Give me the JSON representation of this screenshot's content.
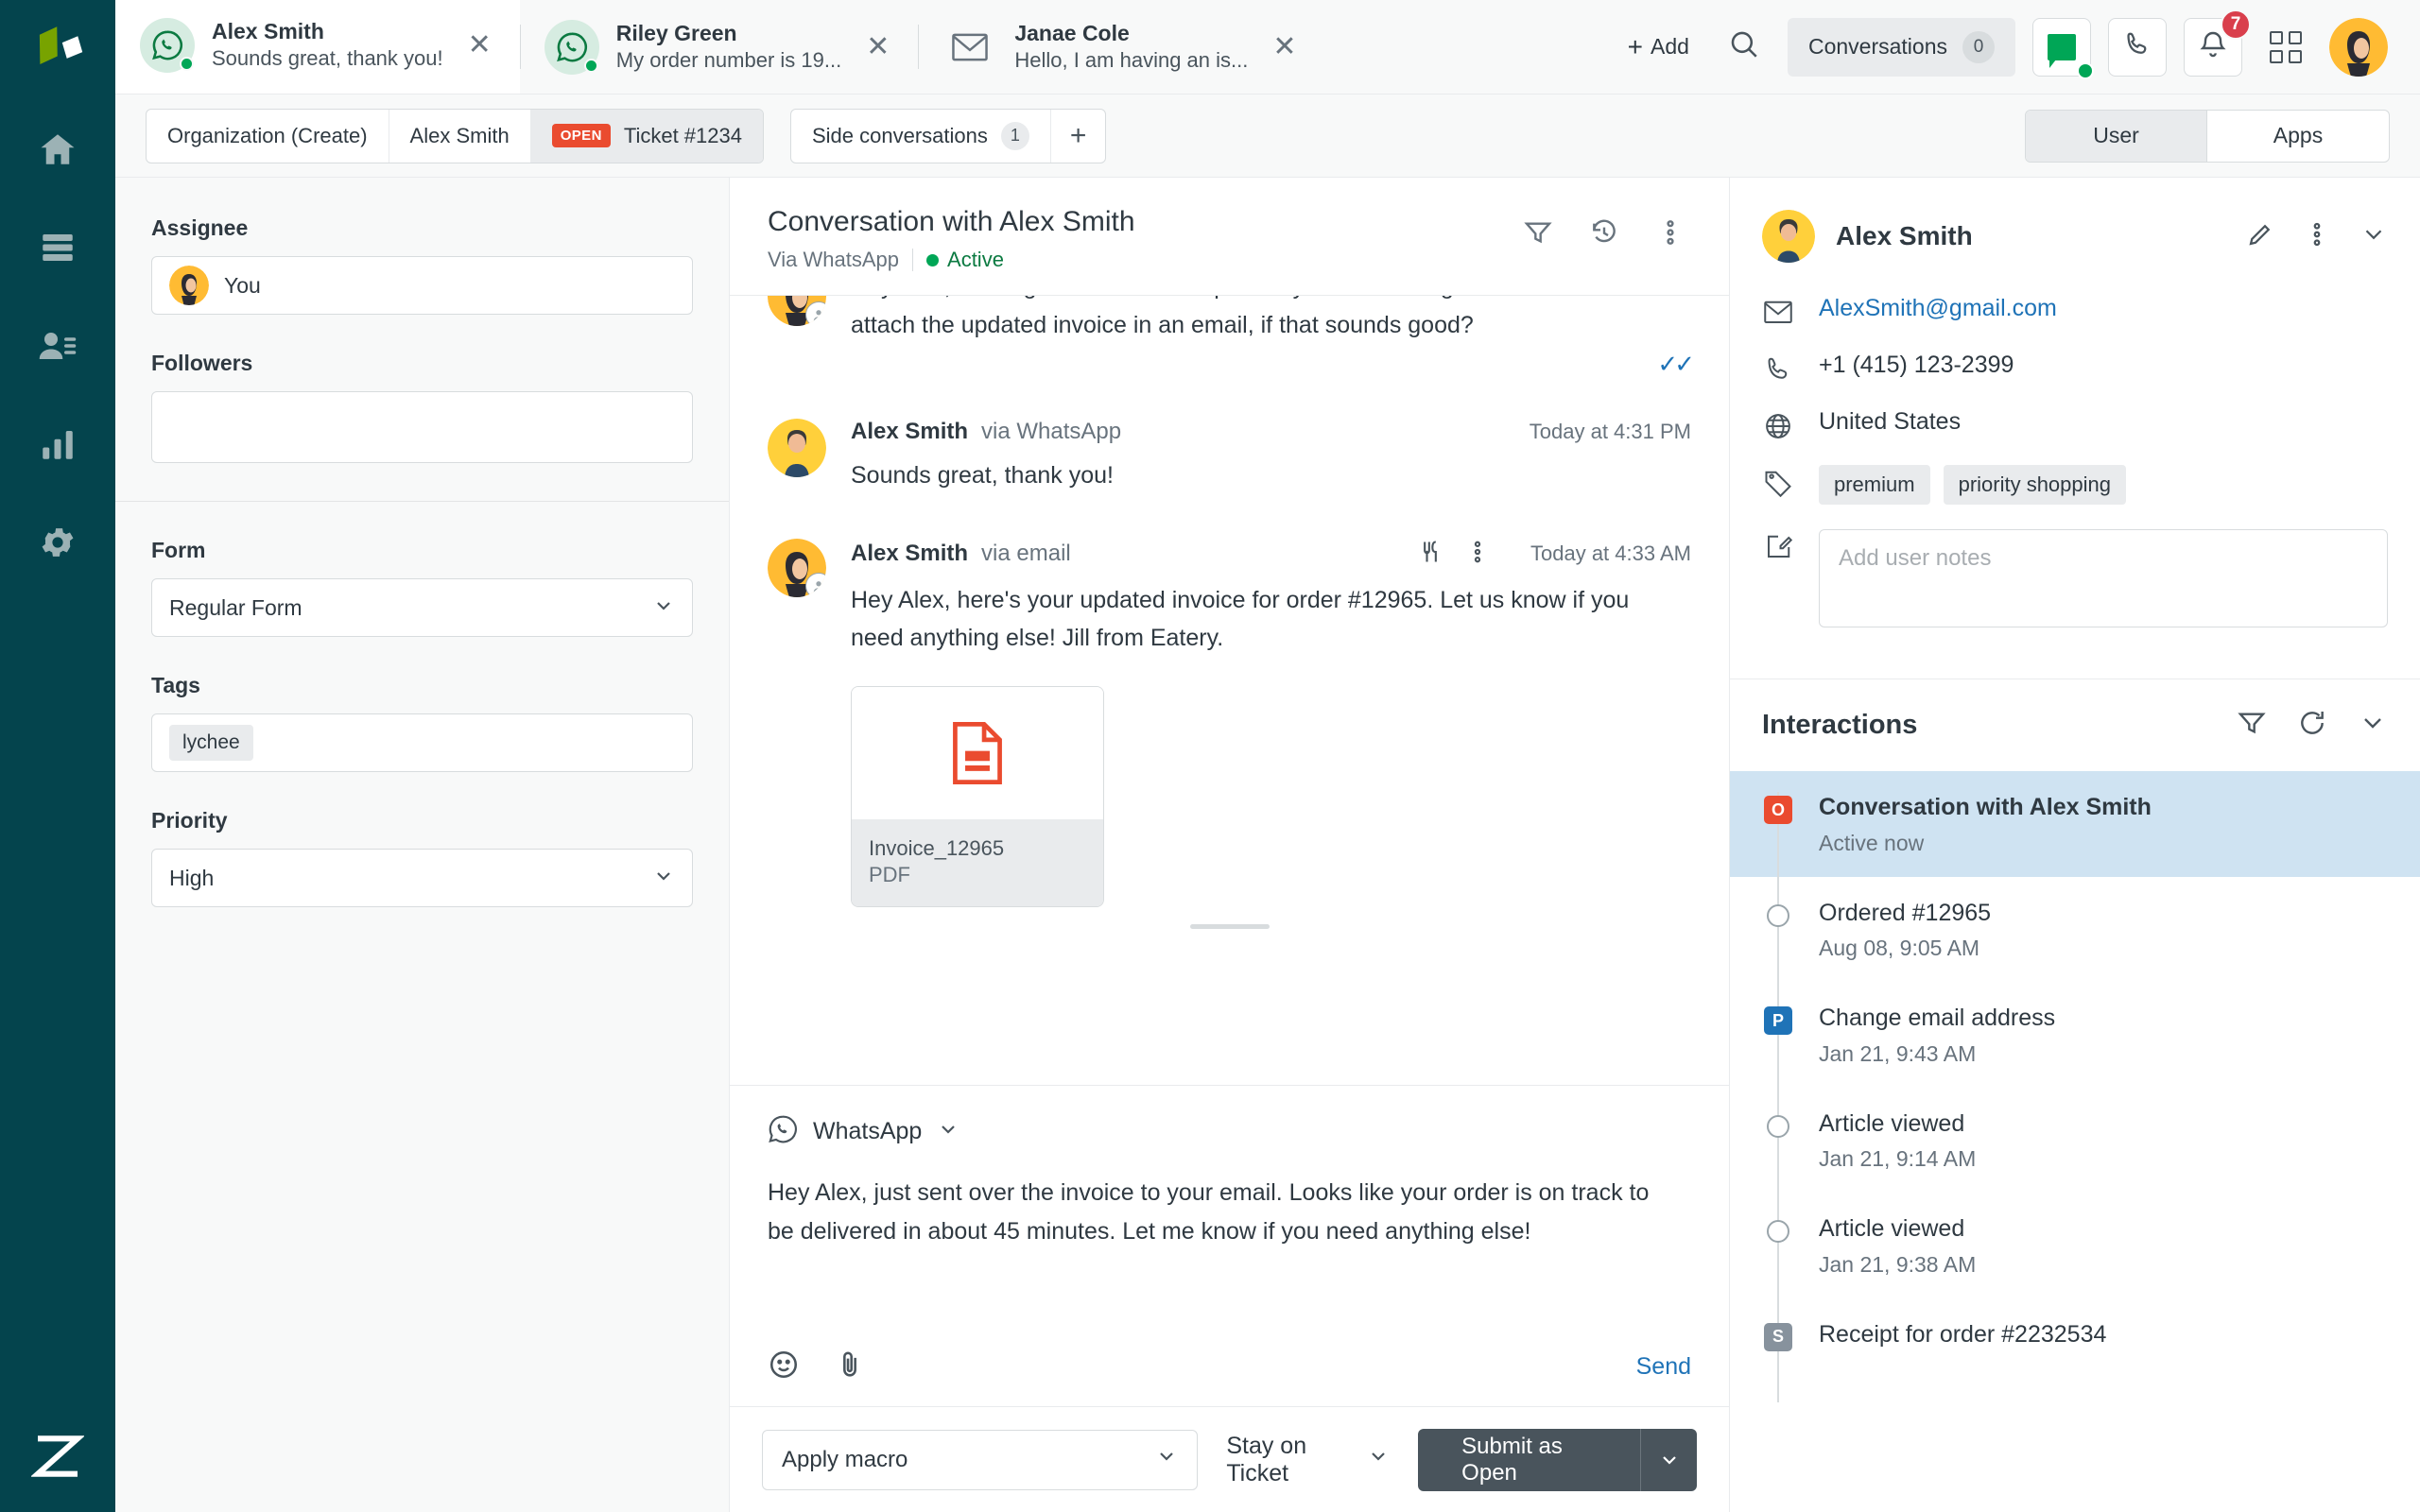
{
  "nav": {
    "logo": "zendesk-logo",
    "items": [
      {
        "name": "home",
        "icon": "home-icon"
      },
      {
        "name": "views",
        "icon": "views-icon"
      },
      {
        "name": "customers",
        "icon": "customers-icon"
      },
      {
        "name": "reporting",
        "icon": "bar-chart-icon"
      },
      {
        "name": "settings",
        "icon": "gear-icon"
      }
    ],
    "footer_logo": "zendesk-z-logo"
  },
  "topbar": {
    "tabs": [
      {
        "name": "Alex Smith",
        "snippet": "Sounds great, thank you!",
        "channel": "whatsapp",
        "online": true,
        "active": true
      },
      {
        "name": "Riley Green",
        "snippet": "My order number is 19...",
        "channel": "whatsapp",
        "online": true,
        "active": false
      },
      {
        "name": "Janae Cole",
        "snippet": "Hello, I am having an is...",
        "channel": "email",
        "online": false,
        "active": false
      }
    ],
    "add_label": "Add",
    "search_icon": "search-icon",
    "conversations_label": "Conversations",
    "conversations_count": "0",
    "chat_icon": "chat-status-icon",
    "phone_icon": "phone-icon",
    "bell_icon": "bell-icon",
    "bell_badge": "7",
    "apps_grid_icon": "grid-apps-icon",
    "avatar_icon": "user-avatar"
  },
  "subbar": {
    "breadcrumbs": [
      {
        "label": "Organization (Create)",
        "active": false,
        "badge": null
      },
      {
        "label": "Alex Smith",
        "active": false,
        "badge": null
      },
      {
        "label": "Ticket #1234",
        "active": true,
        "badge": "OPEN"
      }
    ],
    "side_conversations_label": "Side conversations",
    "side_conversations_count": "1",
    "add_tab_label": "+",
    "segment": [
      {
        "label": "User",
        "selected": true
      },
      {
        "label": "Apps",
        "selected": false
      }
    ]
  },
  "properties": {
    "assignee_label": "Assignee",
    "assignee_value": "You",
    "followers_label": "Followers",
    "followers_value": "",
    "form_label": "Form",
    "form_value": "Regular Form",
    "tags_label": "Tags",
    "tags": [
      "lychee"
    ],
    "priority_label": "Priority",
    "priority_value": "High"
  },
  "conversation": {
    "title": "Conversation with Alex Smith",
    "via": "Via WhatsApp",
    "status": "Active",
    "header_icons": [
      "filter-icon",
      "history-icon",
      "more-vertical-icon"
    ],
    "messages": [
      {
        "author": "",
        "via": "",
        "time": "",
        "body": "Hey Alex, we've gone ahead and updated your order. I'll go ahead and attach the updated invoice in an email, if that sounds good?",
        "read_ticks": "✓✓",
        "avatar": "agent-avatar",
        "show_meta": false
      },
      {
        "author": "Alex Smith",
        "via": "via WhatsApp",
        "time": "Today at 4:31 PM",
        "body": "Sounds great, thank you!",
        "read_ticks": "",
        "avatar": "alex-avatar",
        "show_meta": true
      },
      {
        "author": "Alex Smith",
        "via": "via email",
        "time": "Today at 4:33 AM",
        "body": "Hey Alex, here's your updated invoice for order #12965. Let us know if you need anything else! Jill from Eatery.",
        "read_ticks": "",
        "avatar": "agent-avatar",
        "show_meta": true,
        "inline_icons": [
          "cutlery-icon",
          "more-vertical-icon"
        ],
        "attachment": {
          "filename": "Invoice_12965",
          "filetype": "PDF",
          "icon": "pdf-file-icon"
        }
      }
    ]
  },
  "composer": {
    "channel_icon": "whatsapp-icon",
    "channel_label": "WhatsApp",
    "text": "Hey Alex, just sent over the invoice to your email. Looks like your order is on track to be delivered in about 45 minutes. Let me know if you need anything else!",
    "emoji_icon": "emoji-icon",
    "attach_icon": "paperclip-icon",
    "send_label": "Send"
  },
  "actionbar": {
    "macro_placeholder": "Apply macro",
    "stay_label": "Stay on Ticket",
    "submit_label": "Submit as Open"
  },
  "user_panel": {
    "name": "Alex Smith",
    "avatar": "alex-avatar",
    "header_icons": [
      "pencil-icon",
      "more-vertical-icon",
      "chevron-down-icon"
    ],
    "email": "AlexSmith@gmail.com",
    "phone": "+1 (415) 123-2399",
    "country": "United States",
    "tags": [
      "premium",
      "priority shopping"
    ],
    "notes_placeholder": "Add user notes",
    "notes_value": ""
  },
  "interactions": {
    "title": "Interactions",
    "header_icons": [
      "filter-icon",
      "refresh-icon",
      "chevron-down-icon"
    ],
    "items": [
      {
        "title": "Conversation with Alex Smith",
        "subtitle": "Active now",
        "marker": "square",
        "marker_letter": "O",
        "marker_color": "#ea4b2f",
        "selected": true,
        "bold": true
      },
      {
        "title": "Ordered #12965",
        "subtitle": "Aug 08, 9:05 AM",
        "marker": "circle",
        "marker_letter": "",
        "marker_color": "",
        "selected": false,
        "bold": false
      },
      {
        "title": "Change email address",
        "subtitle": "Jan 21, 9:43 AM",
        "marker": "square",
        "marker_letter": "P",
        "marker_color": "#1f73b7",
        "selected": false,
        "bold": false
      },
      {
        "title": "Article viewed",
        "subtitle": "Jan 21, 9:14 AM",
        "marker": "circle",
        "marker_letter": "",
        "marker_color": "",
        "selected": false,
        "bold": false
      },
      {
        "title": "Article viewed",
        "subtitle": "Jan 21, 9:38 AM",
        "marker": "circle",
        "marker_letter": "",
        "marker_color": "",
        "selected": false,
        "bold": false
      },
      {
        "title": "Receipt for order #2232534",
        "subtitle": "",
        "marker": "square",
        "marker_letter": "S",
        "marker_color": "#87929d",
        "selected": false,
        "bold": false
      }
    ]
  },
  "colors": {
    "brand_dark": "#04444d",
    "accent_green": "#00a656",
    "open_badge": "#ea4b2f",
    "link_blue": "#1f73b7",
    "selected_row": "#cfe3f2"
  }
}
